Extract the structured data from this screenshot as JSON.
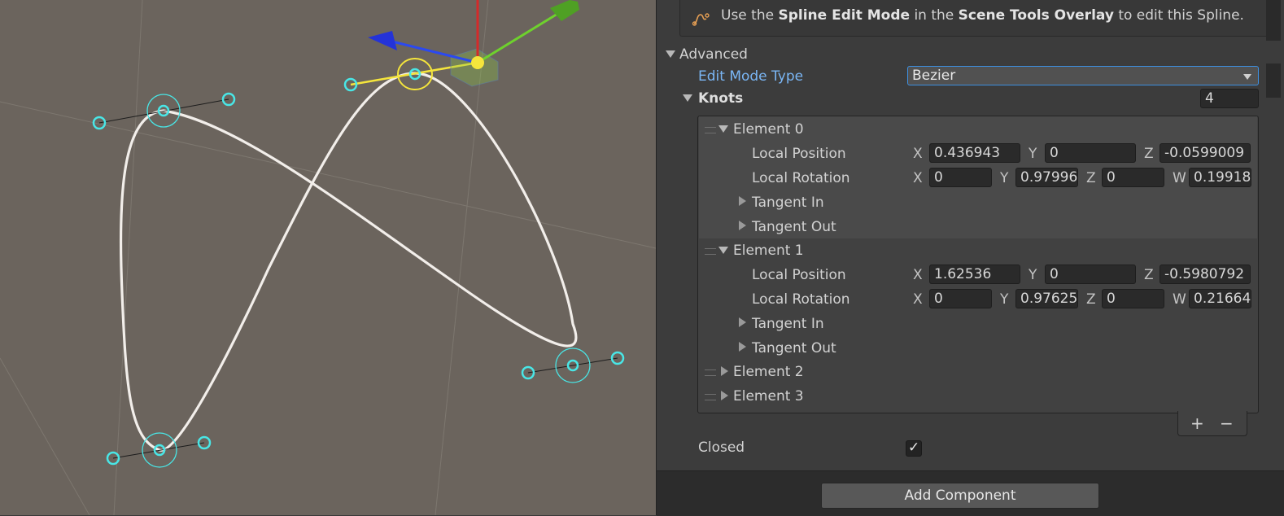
{
  "info": {
    "pre": "Use the ",
    "b1": "Spline Edit Mode",
    "mid": " in the ",
    "b2": "Scene Tools Overlay",
    "post": " to edit this Spline."
  },
  "advanced": {
    "label": "Advanced",
    "edit_mode_label": "Edit Mode Type",
    "edit_mode_value": "Bezier",
    "knots_label": "Knots",
    "knots_count": "4"
  },
  "axes": {
    "x": "X",
    "y": "Y",
    "z": "Z",
    "w": "W"
  },
  "elements": [
    {
      "label": "Element 0",
      "pos_label": "Local Position",
      "pos": {
        "x": "0.436943",
        "y": "0",
        "z": "-0.0599009"
      },
      "rot_label": "Local Rotation",
      "rot": {
        "x": "0",
        "y": "0.97996",
        "z": "0",
        "w": "0.19918"
      },
      "tangent_in": "Tangent In",
      "tangent_out": "Tangent Out"
    },
    {
      "label": "Element 1",
      "pos_label": "Local Position",
      "pos": {
        "x": "1.62536",
        "y": "0",
        "z": "-0.5980792"
      },
      "rot_label": "Local Rotation",
      "rot": {
        "x": "0",
        "y": "0.97625",
        "z": "0",
        "w": "0.21664"
      },
      "tangent_in": "Tangent In",
      "tangent_out": "Tangent Out"
    },
    {
      "label": "Element 2"
    },
    {
      "label": "Element 3"
    }
  ],
  "list_footer": {
    "add": "+",
    "remove": "−"
  },
  "closed": {
    "label": "Closed",
    "checked": "✓"
  },
  "add_component": "Add Component",
  "colors": {
    "scene_bg": "#6b645d",
    "spline": "#f2eeea",
    "knot_handle": "#49e6e6",
    "selected_knot": "#f5e53c",
    "axis_x": "#d42a2a",
    "axis_y": "#6ed12d",
    "axis_z": "#2b49f0",
    "link_blue": "#7ab6f5",
    "field_bg": "#2a2a2a"
  }
}
